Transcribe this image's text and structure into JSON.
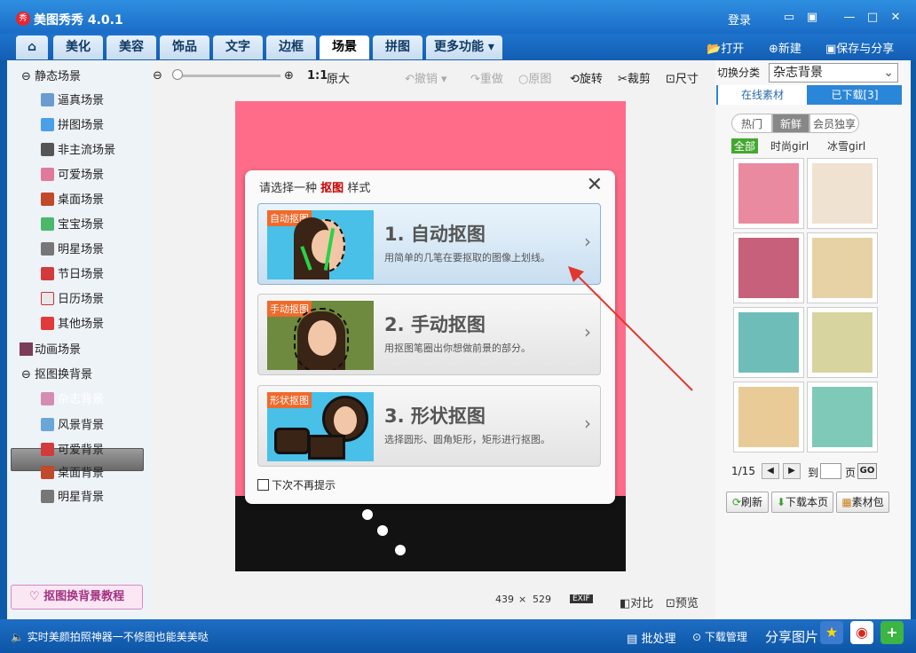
{
  "app": {
    "title": "美图秀秀 4.0.1",
    "logo_text": "秀",
    "login": "登录"
  },
  "nav": {
    "tabs": [
      "美化",
      "美容",
      "饰品",
      "文字",
      "边框",
      "场景",
      "拼图",
      "更多功能"
    ],
    "active": "场景",
    "open": "打开",
    "new": "新建",
    "save_share": "保存与分享"
  },
  "sidebar": {
    "static_group": "静态场景",
    "static_items": [
      "逼真场景",
      "拼图场景",
      "非主流场景",
      "可爱场景",
      "桌面场景",
      "宝宝场景",
      "明星场景",
      "节日场景",
      "日历场景",
      "其他场景"
    ],
    "anim_group": "动画场景",
    "cutout_group": "抠图换背景",
    "cutout_items": [
      "杂志背景",
      "风景背景",
      "可爱背景",
      "桌面背景",
      "明星背景"
    ],
    "active_item": "杂志背景",
    "tutorial": "抠图换背景教程"
  },
  "toolbar": {
    "zoom_ratio": "1:1",
    "original_size": "原大",
    "undo": "撤销",
    "redo": "重做",
    "reset": "原图",
    "rotate": "旋转",
    "crop": "裁剪",
    "resize": "尺寸"
  },
  "dialog": {
    "title_pre": "请选择一种",
    "title_key": "抠图",
    "title_post": "样式",
    "options": [
      {
        "tag": "自动抠图",
        "title": "1. 自动抠图",
        "desc": "用简单的几笔在要抠取的图像上划线。"
      },
      {
        "tag": "手动抠图",
        "title": "2. 手动抠图",
        "desc": "用抠图笔圈出你想做前景的部分。"
      },
      {
        "tag": "形状抠图",
        "title": "3. 形状抠图",
        "desc": "选择圆形、圆角矩形，矩形进行抠图。"
      }
    ],
    "dont_show": "下次不再提示"
  },
  "image_info": {
    "width": "439",
    "times": "×",
    "height": "529",
    "exif": "EXIF",
    "compare": "对比",
    "preview": "预览"
  },
  "right_panel": {
    "category_label": "切换分类",
    "category_value": "杂志背景",
    "tab_online": "在线素材",
    "tab_downloaded": "已下载[3]",
    "pills": [
      "热门",
      "新鲜",
      "会员独享"
    ],
    "filters": [
      "全部",
      "时尚girl",
      "冰雪girl"
    ],
    "page_current": "1/15",
    "goto_label": "到",
    "page_label": "页",
    "go": "GO",
    "refresh": "刷新",
    "download_page": "下载本页",
    "material_pack": "素材包"
  },
  "statusbar": {
    "promo": "实时美颜拍照神器一不修图也能美美哒",
    "batch": "批处理",
    "download_mgr": "下载管理",
    "share": "分享图片"
  },
  "colors": {
    "accent": "#1a6cc6",
    "canvas_bg": "#ff6c8a",
    "tag": "#ef6a2c",
    "arrow": "#e0382e"
  }
}
